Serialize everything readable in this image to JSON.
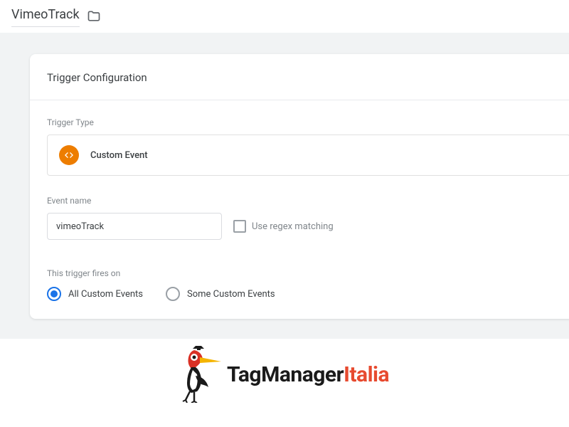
{
  "header": {
    "title": "VimeoTrack"
  },
  "panel": {
    "title": "Trigger Configuration",
    "triggerTypeLabel": "Trigger Type",
    "triggerTypeName": "Custom Event",
    "eventNameLabel": "Event name",
    "eventNameValue": "vimeoTrack",
    "regexLabel": "Use regex matching",
    "firesOnLabel": "This trigger fires on",
    "radioAll": "All Custom Events",
    "radioSome": "Some Custom Events"
  },
  "brand": {
    "part1": "TagManager",
    "part2": "Italia"
  }
}
